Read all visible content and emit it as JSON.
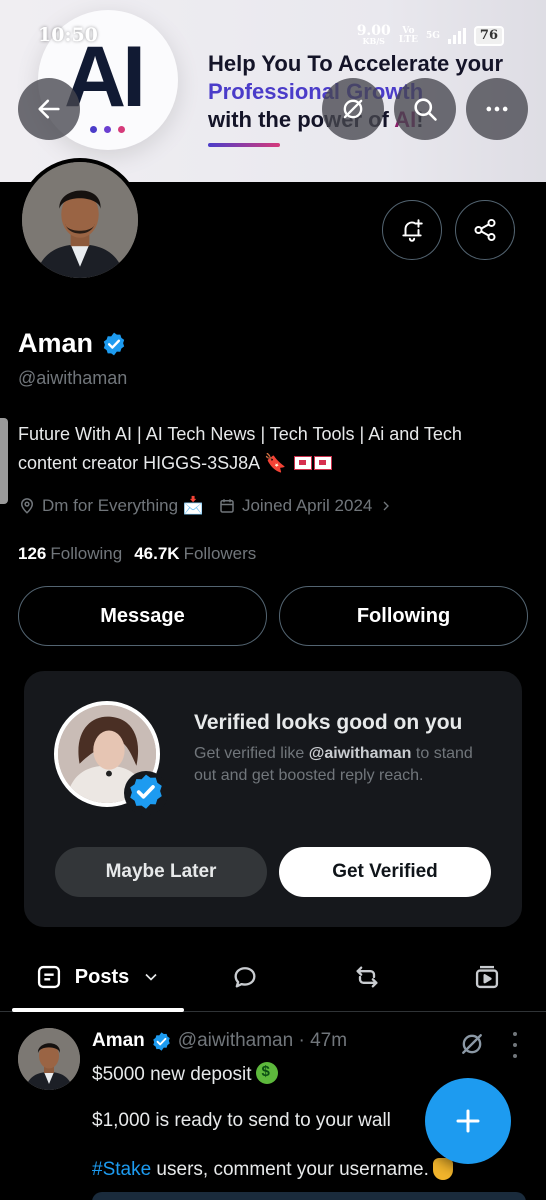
{
  "status_bar": {
    "time": "10:50",
    "speed_value": "9.00",
    "speed_unit": "KB/S",
    "volte_top": "Vo",
    "volte_bottom": "LTE",
    "network": "5G",
    "battery": "76"
  },
  "banner": {
    "logo_text": "AI",
    "headline_line1": "Help You To Accelerate your",
    "headline_line2": "Professional Growth",
    "headline_line3_a": "with the power of ",
    "headline_line3_b": "AI",
    "headline_line3_c": "!"
  },
  "profile": {
    "name": "Aman",
    "handle": "@aiwithaman",
    "bio_line1": "Future With AI | AI Tech News | Tech Tools | Ai and Tech",
    "bio_line2": "content  creator  HIGGS-3SJ8A 🔖",
    "location": "Dm for Everything 📩",
    "joined": "Joined April 2024",
    "following_count": "126",
    "following_label": "Following",
    "followers_count": "46.7K",
    "followers_label": "Followers",
    "message_label": "Message",
    "following_button_label": "Following"
  },
  "verify_card": {
    "title": "Verified looks good on you",
    "desc_prefix": "Get verified like ",
    "desc_handle": "@aiwithaman",
    "desc_suffix": " to stand out and get boosted reply reach.",
    "maybe_later": "Maybe Later",
    "get_verified": "Get Verified"
  },
  "tabs": {
    "posts_label": "Posts"
  },
  "post": {
    "author": "Aman",
    "handle_time": "@aiwithaman · 47m",
    "line1": "$5000 new deposit",
    "line2": "$1,000 is ready to send to your wall",
    "hashtag": "#Stake",
    "line3_rest": " users, comment your username."
  },
  "colors": {
    "accent": "#1d9bf0",
    "background": "#000000",
    "muted": "#71767b"
  },
  "icons": [
    "back-arrow-icon",
    "grok-icon",
    "search-icon",
    "more-icon",
    "notification-bell-icon",
    "share-icon",
    "verified-badge-icon",
    "location-pin-icon",
    "calendar-icon",
    "chevron-right-icon",
    "posts-list-icon",
    "chevron-down-icon",
    "reply-bubble-icon",
    "repost-icon",
    "media-icon",
    "compose-plus-icon"
  ]
}
